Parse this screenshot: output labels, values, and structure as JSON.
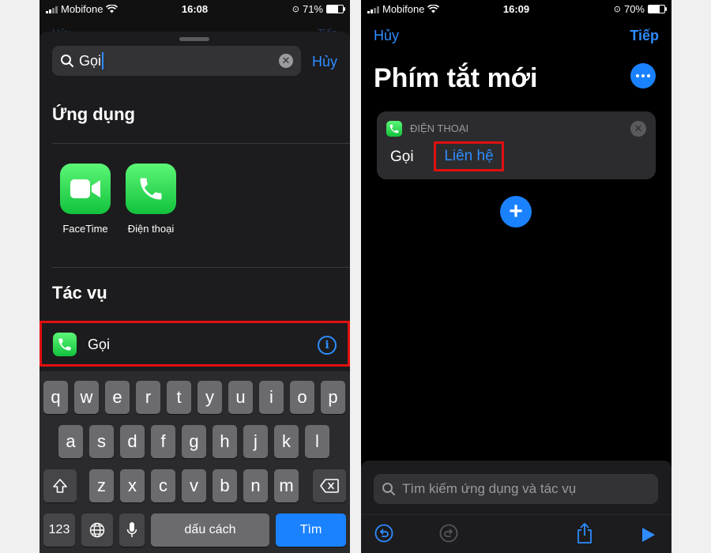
{
  "left": {
    "status": {
      "carrier": "Mobifone",
      "time": "16:08",
      "battery": "71%",
      "battery_level": 0.71
    },
    "behind": {
      "left": "Hủy",
      "right": "Tiếp"
    },
    "search": {
      "query": "Gọi",
      "cancel": "Hủy"
    },
    "apps_section": {
      "title": "Ứng dụng",
      "items": [
        {
          "label": "FaceTime",
          "icon": "video-camera-icon"
        },
        {
          "label": "Điện thoại",
          "icon": "phone-icon"
        }
      ]
    },
    "actions_section": {
      "title": "Tác vụ",
      "item": {
        "label": "Gọi",
        "icon": "phone-icon"
      }
    },
    "keyboard": {
      "row1": [
        "q",
        "w",
        "e",
        "r",
        "t",
        "y",
        "u",
        "i",
        "o",
        "p"
      ],
      "row2": [
        "a",
        "s",
        "d",
        "f",
        "g",
        "h",
        "j",
        "k",
        "l"
      ],
      "row3": [
        "z",
        "x",
        "c",
        "v",
        "b",
        "n",
        "m"
      ],
      "numbers": "123",
      "space": "dấu cách",
      "return": "Tìm"
    }
  },
  "right": {
    "status": {
      "carrier": "Mobifone",
      "time": "16:09",
      "battery": "70%",
      "battery_level": 0.7
    },
    "nav": {
      "cancel": "Hủy",
      "next": "Tiếp"
    },
    "title": "Phím tắt mới",
    "action_card": {
      "app": "ĐIỆN THOẠI",
      "verb": "Gọi",
      "param": "Liên hệ"
    },
    "search_placeholder": "Tìm kiếm ứng dụng và tác vụ"
  },
  "colors": {
    "accent": "#1a82ff",
    "highlight": "#e01010",
    "phone_green": "#34c759"
  }
}
